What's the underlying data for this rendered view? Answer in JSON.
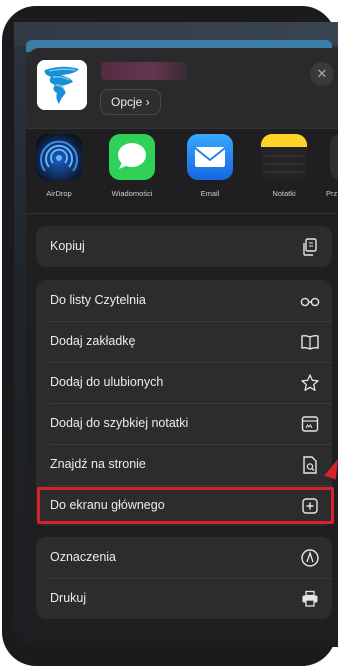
{
  "header": {
    "options_label": "Opcje ›",
    "close_glyph": "✕"
  },
  "share_targets": [
    {
      "label": "AirDrop",
      "icon": "airdrop-icon"
    },
    {
      "label": "Wiadomości",
      "icon": "messages-icon"
    },
    {
      "label": "Email",
      "icon": "mail-icon"
    },
    {
      "label": "Notatki",
      "icon": "notes-icon"
    },
    {
      "label": "Prz",
      "icon": "app-icon"
    }
  ],
  "actions": {
    "copy": {
      "label": "Kopiuj",
      "icon": "copy-icon"
    },
    "reading_list": {
      "label": "Do listy Czytelnia",
      "icon": "glasses-icon"
    },
    "bookmark": {
      "label": "Dodaj zakładkę",
      "icon": "book-icon"
    },
    "favorites": {
      "label": "Dodaj do ulubionych",
      "icon": "star-icon"
    },
    "quick_note": {
      "label": "Dodaj do szybkiej notatki",
      "icon": "quick-note-icon"
    },
    "find": {
      "label": "Znajdź na stronie",
      "icon": "find-doc-icon"
    },
    "home_screen": {
      "label": "Do ekranu głównego",
      "icon": "plus-square-icon"
    },
    "markup": {
      "label": "Oznaczenia",
      "icon": "markup-icon"
    },
    "print": {
      "label": "Drukuj",
      "icon": "printer-icon"
    }
  },
  "colors": {
    "highlight": "#d9232c",
    "sheet_bg": "#1f1f21",
    "group_bg": "#2c2c2e",
    "messages_green": "#30d158",
    "mail_blue": "#1e8cf4",
    "notes_yellow": "#ffd426"
  }
}
